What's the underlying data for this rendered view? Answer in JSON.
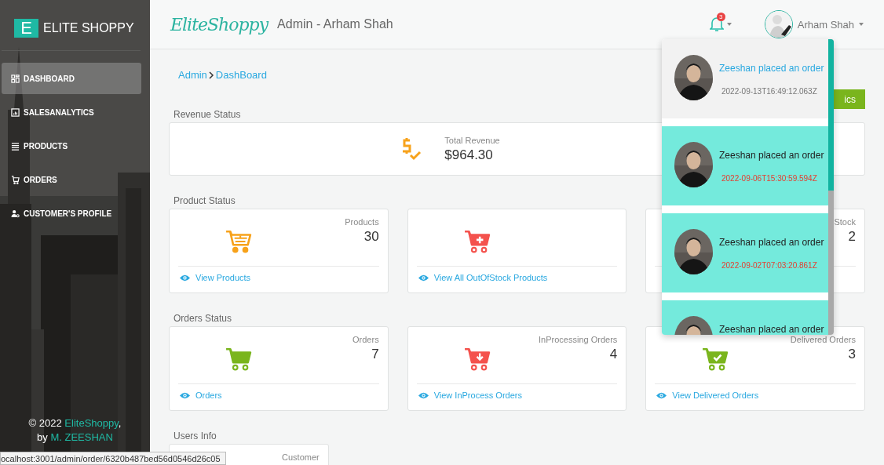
{
  "sidebar": {
    "logo_letter": "E",
    "brand": "ELITE SHOPPY",
    "items": [
      {
        "label": "DASHBOARD",
        "kind": "dashboard",
        "selected": true
      },
      {
        "label": "SALESANALYTICS",
        "kind": "analytics",
        "selected": false
      },
      {
        "label": "PRODUCTS",
        "kind": "list",
        "selected": false
      },
      {
        "label": "ORDERS",
        "kind": "cart",
        "selected": false
      },
      {
        "label": "CUSTOMER'S PROFILE",
        "kind": "user",
        "selected": false
      }
    ],
    "footer": {
      "copyright": "© 2022",
      "brand": "EliteShoppy",
      "comma": ",",
      "by": "by",
      "author": "M. ZEESHAN"
    }
  },
  "header": {
    "logo": "EliteShoppy",
    "title": "Admin - Arham Shah",
    "notification_count": "3",
    "user_name": "Arham Shah"
  },
  "breadcrumb": [
    "Admin",
    "DashBoard"
  ],
  "action_button": "ics",
  "revenue": {
    "heading": "Revenue Status",
    "label": "Total Revenue",
    "value": "$964.30"
  },
  "sections": [
    {
      "heading": "Product Status",
      "cards": [
        {
          "kind": "cart-outline",
          "color": "#f7a21b",
          "label": "Products",
          "value": "30",
          "link": "View Products"
        },
        {
          "kind": "cart-plus",
          "color": "#f4524d",
          "link": "View All OutOfStock Products"
        },
        {
          "label": "Stock",
          "value": "2"
        }
      ]
    },
    {
      "heading": "Orders Status",
      "cards": [
        {
          "kind": "cart",
          "color": "#7ab51d",
          "label": "Orders",
          "value": "7",
          "link": "Orders"
        },
        {
          "kind": "cart-down",
          "color": "#f4524d",
          "label": "InProcessing Orders",
          "value": "4",
          "link": "View InProcess Orders"
        },
        {
          "kind": "cart-check",
          "color": "#7ab51d",
          "label": "Delivered Orders",
          "value": "3",
          "link": "View Delivered Orders"
        }
      ]
    },
    {
      "heading": "Users Info",
      "cards": [
        {
          "label": "Customer"
        }
      ]
    }
  ],
  "notifications": [
    {
      "text": "Zeeshan placed an order",
      "time": "2022-09-13T16:49:12.063Z",
      "unread": false
    },
    {
      "text": "Zeeshan placed an order",
      "time": "2022-09-06T15:30:59.594Z",
      "unread": true
    },
    {
      "text": "Zeeshan placed an order",
      "time": "2022-09-02T07:03:20.861Z",
      "unread": true
    },
    {
      "text": "Zeeshan placed an order",
      "unread": true
    }
  ],
  "status_url": "ocalhost:3001/admin/order/6320b487bed56d0546d26c05"
}
